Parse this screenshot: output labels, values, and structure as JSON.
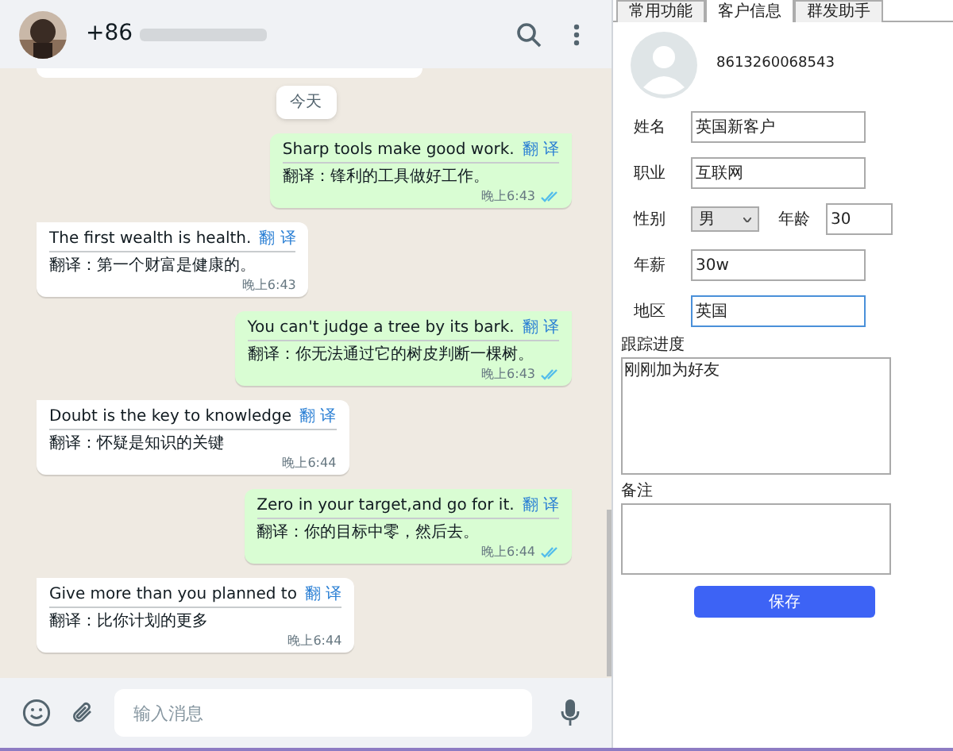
{
  "chat": {
    "header": {
      "phone_prefix": "+86"
    },
    "date_chip": "今天",
    "messages": [
      {
        "outgoing": true,
        "text": "Sharp tools make good work.",
        "link": "翻 译",
        "translation": "翻译：锋利的工具做好工作。",
        "time": "晚上6:43",
        "read": true
      },
      {
        "outgoing": false,
        "text": "The first wealth is health.",
        "link": "翻 译",
        "translation": "翻译：第一个财富是健康的。",
        "time": "晚上6:43"
      },
      {
        "outgoing": true,
        "text": "You can't judge a tree by its bark.",
        "link": "翻 译",
        "translation": "翻译：你无法通过它的树皮判断一棵树。",
        "time": "晚上6:43",
        "read": true
      },
      {
        "outgoing": false,
        "text": "Doubt is the key to knowledge",
        "link": "翻 译",
        "translation": "翻译：怀疑是知识的关键",
        "time": "晚上6:44"
      },
      {
        "outgoing": true,
        "text": "Zero in your target,and go for it.",
        "link": "翻 译",
        "translation": "翻译：你的目标中零，然后去。",
        "time": "晚上6:44",
        "read": true
      },
      {
        "outgoing": false,
        "text": "Give more than you planned to",
        "link": "翻 译",
        "translation": "翻译：比你计划的更多",
        "time": "晚上6:44"
      }
    ],
    "composer": {
      "placeholder": "输入消息"
    }
  },
  "panel": {
    "tabs": [
      {
        "label": "常用功能",
        "selected": false
      },
      {
        "label": "客户信息",
        "selected": true
      },
      {
        "label": "群发助手",
        "selected": false
      }
    ],
    "phone": "8613260068543",
    "fields": [
      {
        "kind": "text",
        "label": "姓名",
        "value": "英国新客户",
        "focused": false
      },
      {
        "kind": "text",
        "label": "职业",
        "value": "互联网",
        "focused": false
      },
      {
        "kind": "pair",
        "label": "性别",
        "value": "男",
        "label2": "年龄",
        "value2": "30"
      },
      {
        "kind": "text",
        "label": "年薪",
        "value": "30w",
        "focused": false
      },
      {
        "kind": "text",
        "label": "地区",
        "value": "英国",
        "focused": true
      }
    ],
    "progress": {
      "label": "跟踪进度",
      "value": "刚刚加为好友"
    },
    "notes": {
      "label": "备注"
    },
    "save_button": "保存"
  }
}
